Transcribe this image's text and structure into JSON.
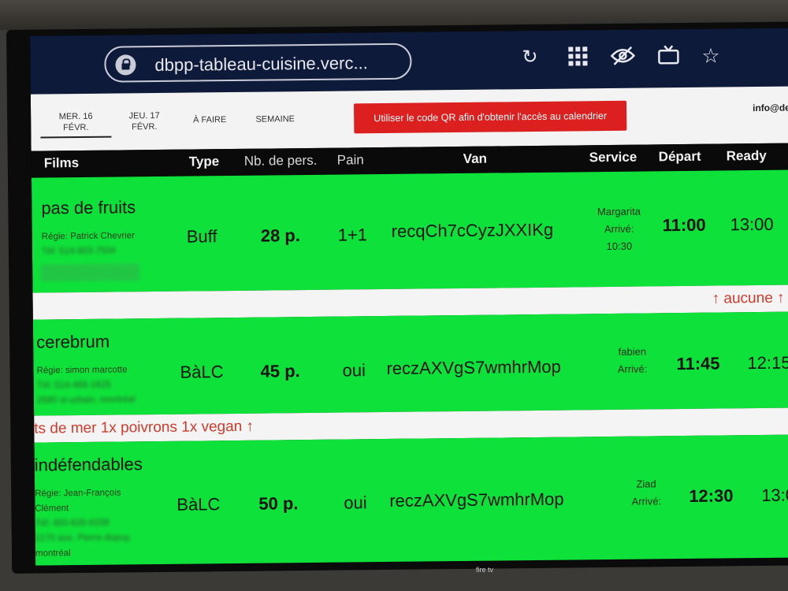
{
  "browser": {
    "url": "dbpp-tableau-cuisine.verc...",
    "icons": [
      "lock-icon",
      "reload-icon",
      "grid-icon",
      "eye-off-icon",
      "tv-icon",
      "star-icon"
    ]
  },
  "nav": {
    "tabs": [
      {
        "line1": "MER. 16",
        "line2": "FÉVR."
      },
      {
        "line1": "JEU. 17",
        "line2": "FÉVR."
      },
      {
        "line1": "À FAIRE",
        "line2": ""
      },
      {
        "line1": "SEMAINE",
        "line2": ""
      }
    ],
    "banner": "Utiliser le code QR afin d'obtenir l'accès au calendrier",
    "email": "info@de"
  },
  "columns": {
    "films": "Films",
    "type": "Type",
    "pers": "Nb. de pers.",
    "pain": "Pain",
    "van": "Van",
    "service": "Service",
    "depart": "Départ",
    "ready": "Ready"
  },
  "rows": [
    {
      "film": "pas de fruits",
      "regie": "Régie: Patrick Chevrier",
      "tel": "Tél: 514-803-7504",
      "addr": "",
      "type": "Buff",
      "pers": "28 p.",
      "pain": "1+1",
      "van": "recqCh7cCyzJXXIKg",
      "service_name": "Margarita",
      "arrive_label": "Arrivé:",
      "arrive_time": "10:30",
      "depart": "11:00",
      "ready": "13:00",
      "note": "↑ aucune ↑"
    },
    {
      "film": "cerebrum",
      "regie": "Régie: simon marcotte",
      "tel": "Tél: 514-466-1625",
      "addr": "2580 st-urbain, montréal",
      "type": "BàLC",
      "pers": "45 p.",
      "pain": "oui",
      "van": "reczAXVgS7wmhrMop",
      "service_name": "fabien",
      "arrive_label": "Arrivé:",
      "arrive_time": "",
      "depart": "11:45",
      "ready": "12:15",
      "note": "ts de mer 1x poivrons 1x vegan ↑"
    },
    {
      "film": "indéfendables",
      "regie": "Régie: Jean-François",
      "regie2": "Clément",
      "tel": "Tél: 450-626-6339",
      "addr": "2170 ave. Pierre-dupuy,",
      "city": "montréal",
      "type": "BàLC",
      "pers": "50 p.",
      "pain": "oui",
      "van": "reczAXVgS7wmhrMop",
      "service_name": "Ziad",
      "arrive_label": "Arrivé:",
      "arrive_time": "",
      "depart": "12:30",
      "ready": "13:0"
    }
  ],
  "tv": {
    "brand": "fire tv"
  }
}
